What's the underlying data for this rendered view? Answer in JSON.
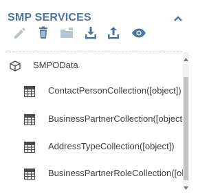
{
  "panel": {
    "title": "SMP SERVICES",
    "accent_color": "#4a74a2",
    "toolbar": [
      {
        "name": "edit-icon",
        "enabled": false
      },
      {
        "name": "delete-icon",
        "enabled": true
      },
      {
        "name": "folder-icon",
        "enabled": false
      },
      {
        "name": "download-icon",
        "enabled": true
      },
      {
        "name": "upload-icon",
        "enabled": true
      },
      {
        "name": "view-icon",
        "enabled": true
      }
    ],
    "collapse_icon": "chevron-up-icon"
  },
  "tree": {
    "root": {
      "label": "SMPOData",
      "icon": "cube-icon"
    },
    "items": [
      {
        "label": "ContactPersonCollection([object])",
        "icon": "table-icon"
      },
      {
        "label": "BusinessPartnerCollection([object",
        "icon": "table-icon"
      },
      {
        "label": "AddressTypeCollection([object])",
        "icon": "table-icon"
      },
      {
        "label": "BusinessPartnerRoleCollection([ol",
        "icon": "table-icon"
      }
    ]
  }
}
